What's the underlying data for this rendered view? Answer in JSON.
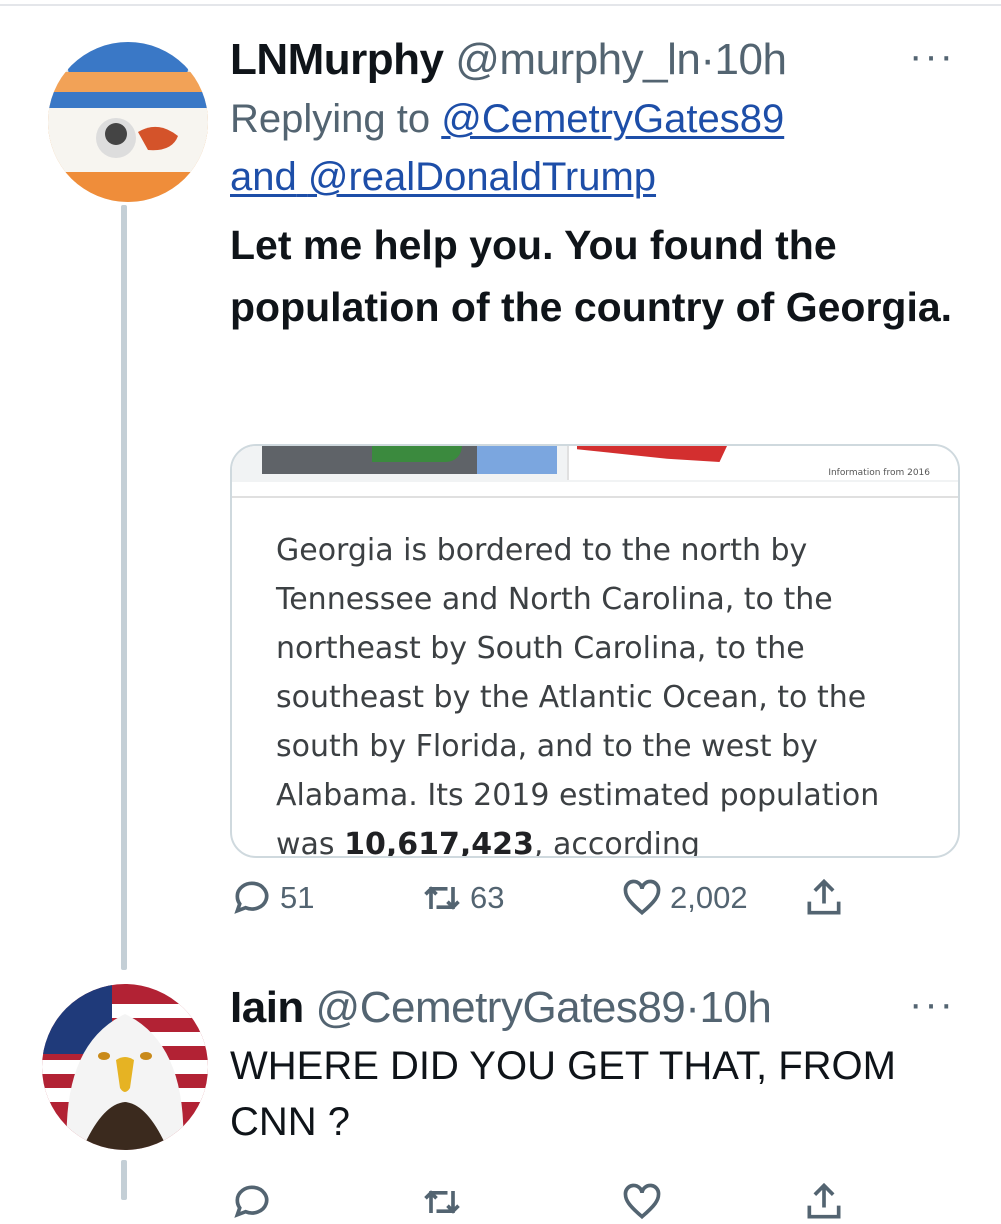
{
  "tweets": [
    {
      "name": "LNMurphy",
      "handle": "@murphy_ln",
      "separator": "·",
      "time": "10h",
      "more": "···",
      "replying_prefix": "Replying to",
      "replying_to": [
        "@CemetryGates89",
        "@realDonaldTrump"
      ],
      "replying_joiner": "and",
      "text": "Let me help you. You found the population of the country of Georgia.",
      "card": {
        "info_note": "Information from 2016",
        "text_before": "Georgia is bordered to the north by Tennessee and North Carolina, to the northeast by South Carolina, to the southeast by the Atlantic Ocean, to the south by Florida, and to the west by Alabama. Its 2019 estimated population was ",
        "highlight": "10,617,423",
        "text_after": ", according"
      },
      "actions": {
        "replies": "51",
        "retweets": "63",
        "likes": "2,002"
      }
    },
    {
      "name": "Iain",
      "handle": "@CemetryGates89",
      "separator": "·",
      "time": "10h",
      "more": "···",
      "text": "WHERE DID YOU GET THAT, FROM CNN ?"
    }
  ],
  "icons": [
    "reply-icon",
    "retweet-icon",
    "like-icon",
    "share-icon",
    "more-icon"
  ],
  "colors": {
    "link": "#1d4ea8",
    "secondary": "#536471",
    "thread_line": "#c4cfd6"
  }
}
